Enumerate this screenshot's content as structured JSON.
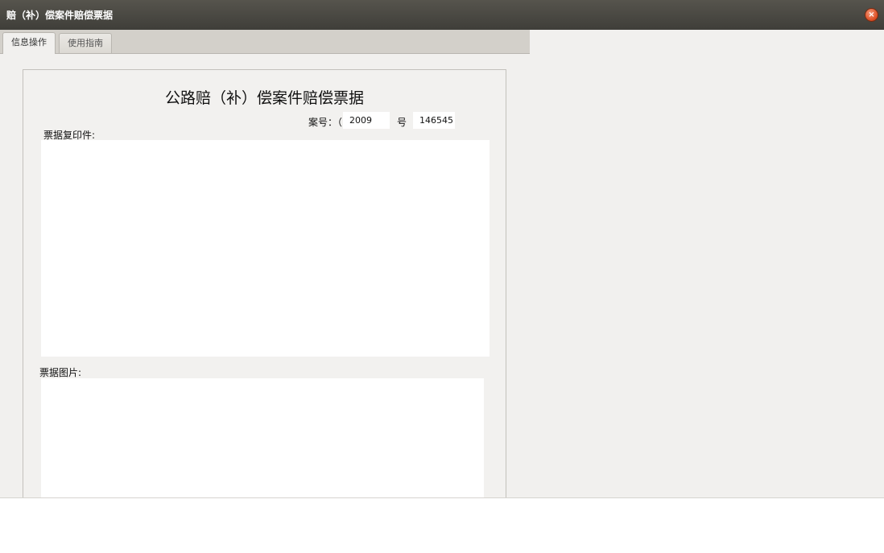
{
  "window": {
    "title": "赔（补）偿案件赔偿票据",
    "close_symbol": "×"
  },
  "tabs": [
    {
      "label": "信息操作",
      "active": true
    },
    {
      "label": "使用指南",
      "active": false
    }
  ],
  "form": {
    "doc_title": "公路赔（补）偿案件赔偿票据",
    "case_label": "案号：（",
    "case_year": "2009",
    "case_mid": "号",
    "case_number": "146545",
    "receipt_copy_label": "票据复印件:",
    "receipt_image_label": "票据图片:"
  }
}
